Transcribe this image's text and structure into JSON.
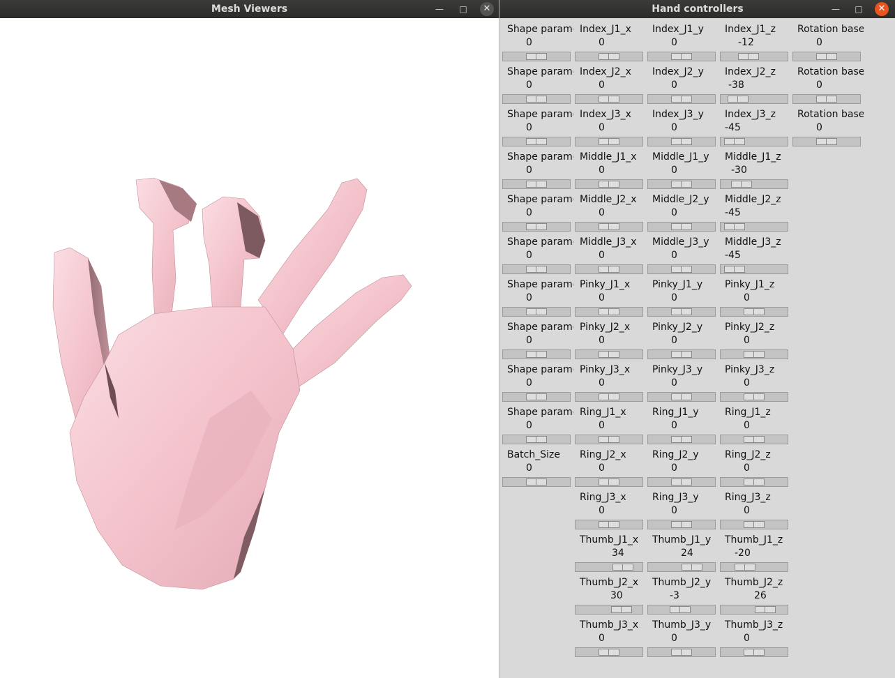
{
  "viewer": {
    "title": "Mesh Viewers"
  },
  "controls": {
    "title": "Hand controllers",
    "columns": [
      [
        {
          "label": "Shape parame",
          "value": "0",
          "level": 0.5
        },
        {
          "label": "Shape parame",
          "value": "0",
          "level": 0.5
        },
        {
          "label": "Shape parame",
          "value": "0",
          "level": 0.5
        },
        {
          "label": "Shape parame",
          "value": "0",
          "level": 0.5
        },
        {
          "label": "Shape parame",
          "value": "0",
          "level": 0.5
        },
        {
          "label": "Shape parame",
          "value": "0",
          "level": 0.5
        },
        {
          "label": "Shape parame",
          "value": "0",
          "level": 0.5
        },
        {
          "label": "Shape parame",
          "value": "0",
          "level": 0.5
        },
        {
          "label": "Shape parame",
          "value": "0",
          "level": 0.5
        },
        {
          "label": "Shape parame",
          "value": "0",
          "level": 0.5
        },
        {
          "label": "Batch_Size",
          "value": "0",
          "level": 0.5
        }
      ],
      [
        {
          "label": "Index_J1_x",
          "value": "0",
          "level": 0.5
        },
        {
          "label": "Index_J2_x",
          "value": "0",
          "level": 0.5
        },
        {
          "label": "Index_J3_x",
          "value": "0",
          "level": 0.5
        },
        {
          "label": "Middle_J1_x",
          "value": "0",
          "level": 0.5
        },
        {
          "label": "Middle_J2_x",
          "value": "0",
          "level": 0.5
        },
        {
          "label": "Middle_J3_x",
          "value": "0",
          "level": 0.5
        },
        {
          "label": "Pinky_J1_x",
          "value": "0",
          "level": 0.5
        },
        {
          "label": "Pinky_J2_x",
          "value": "0",
          "level": 0.5
        },
        {
          "label": "Pinky_J3_x",
          "value": "0",
          "level": 0.5
        },
        {
          "label": "Ring_J1_x",
          "value": "0",
          "level": 0.5
        },
        {
          "label": "Ring_J2_x",
          "value": "0",
          "level": 0.5
        },
        {
          "label": "Ring_J3_x",
          "value": "0",
          "level": 0.5
        },
        {
          "label": "Thumb_J1_x",
          "value": "34",
          "level": 0.8
        },
        {
          "label": "Thumb_J2_x",
          "value": "30",
          "level": 0.77
        },
        {
          "label": "Thumb_J3_x",
          "value": "0",
          "level": 0.5
        }
      ],
      [
        {
          "label": "Index_J1_y",
          "value": "0",
          "level": 0.5
        },
        {
          "label": "Index_J2_y",
          "value": "0",
          "level": 0.5
        },
        {
          "label": "Index_J3_y",
          "value": "0",
          "level": 0.5
        },
        {
          "label": "Middle_J1_y",
          "value": "0",
          "level": 0.5
        },
        {
          "label": "Middle_J2_y",
          "value": "0",
          "level": 0.5
        },
        {
          "label": "Middle_J3_y",
          "value": "0",
          "level": 0.5
        },
        {
          "label": "Pinky_J1_y",
          "value": "0",
          "level": 0.5
        },
        {
          "label": "Pinky_J2_y",
          "value": "0",
          "level": 0.5
        },
        {
          "label": "Pinky_J3_y",
          "value": "0",
          "level": 0.5
        },
        {
          "label": "Ring_J1_y",
          "value": "0",
          "level": 0.5
        },
        {
          "label": "Ring_J2_y",
          "value": "0",
          "level": 0.5
        },
        {
          "label": "Ring_J3_y",
          "value": "0",
          "level": 0.5
        },
        {
          "label": "Thumb_J1_y",
          "value": "24",
          "level": 0.72
        },
        {
          "label": "Thumb_J2_y",
          "value": "-3",
          "level": 0.47
        },
        {
          "label": "Thumb_J3_y",
          "value": "0",
          "level": 0.5
        }
      ],
      [
        {
          "label": "Index_J1_z",
          "value": "-12",
          "level": 0.38
        },
        {
          "label": "Index_J2_z",
          "value": "-38",
          "level": 0.15
        },
        {
          "label": "Index_J3_z",
          "value": "-45",
          "level": 0.08
        },
        {
          "label": "Middle_J1_z",
          "value": "-30",
          "level": 0.22
        },
        {
          "label": "Middle_J2_z",
          "value": "-45",
          "level": 0.08
        },
        {
          "label": "Middle_J3_z",
          "value": "-45",
          "level": 0.08
        },
        {
          "label": "Pinky_J1_z",
          "value": "0",
          "level": 0.5
        },
        {
          "label": "Pinky_J2_z",
          "value": "0",
          "level": 0.5
        },
        {
          "label": "Pinky_J3_z",
          "value": "0",
          "level": 0.5
        },
        {
          "label": "Ring_J1_z",
          "value": "0",
          "level": 0.5
        },
        {
          "label": "Ring_J2_z",
          "value": "0",
          "level": 0.5
        },
        {
          "label": "Ring_J3_z",
          "value": "0",
          "level": 0.5
        },
        {
          "label": "Thumb_J1_z",
          "value": "-20",
          "level": 0.3
        },
        {
          "label": "Thumb_J2_z",
          "value": "26",
          "level": 0.74
        },
        {
          "label": "Thumb_J3_z",
          "value": "0",
          "level": 0.5
        }
      ],
      [
        {
          "label": "Rotation base",
          "value": "0",
          "level": 0.5
        },
        {
          "label": "Rotation base",
          "value": "0",
          "level": 0.5
        },
        {
          "label": "Rotation base",
          "value": "0",
          "level": 0.5
        }
      ]
    ]
  },
  "colors": {
    "mesh": "#f7c8d0",
    "mesh_shadow": "#8a6268",
    "close_active": "#e95420"
  }
}
